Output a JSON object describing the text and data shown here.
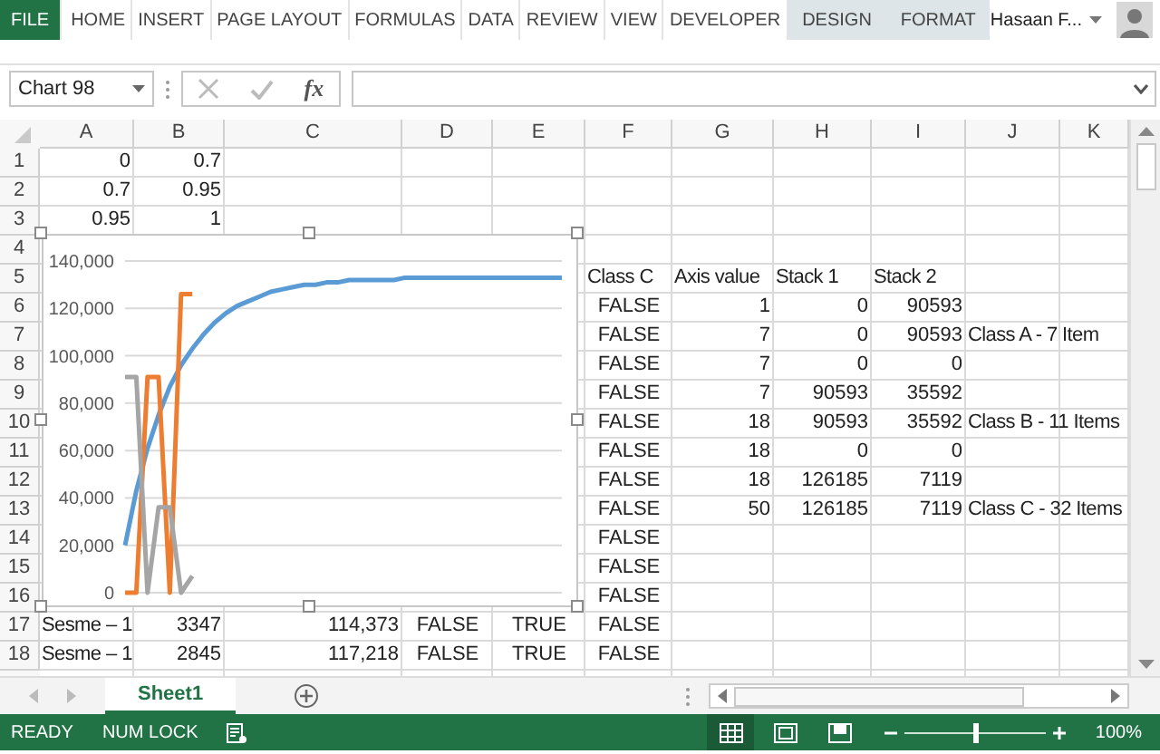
{
  "ribbon_tabs": [
    {
      "label": "FILE",
      "kind": "file"
    },
    {
      "label": "HOME",
      "kind": "tab"
    },
    {
      "label": "INSERT",
      "kind": "tab"
    },
    {
      "label": "PAGE LAYOUT",
      "kind": "tab"
    },
    {
      "label": "FORMULAS",
      "kind": "tab"
    },
    {
      "label": "DATA",
      "kind": "tab"
    },
    {
      "label": "REVIEW",
      "kind": "tab"
    },
    {
      "label": "VIEW",
      "kind": "tab"
    },
    {
      "label": "DEVELOPER",
      "kind": "tab"
    },
    {
      "label": "DESIGN",
      "kind": "context"
    },
    {
      "label": "FORMAT",
      "kind": "context"
    }
  ],
  "user": {
    "name": "Hasaan F..."
  },
  "formula_bar": {
    "name_box": "Chart 98",
    "fx_label": "fx"
  },
  "sheet": {
    "columns": [
      "A",
      "B",
      "C",
      "D",
      "E",
      "F",
      "G",
      "H",
      "I",
      "J",
      "K"
    ],
    "rows": [
      {
        "number": "1",
        "cells": {
          "A": {
            "value": "0",
            "kind": "number"
          },
          "B": {
            "value": "0.7",
            "kind": "number"
          }
        }
      },
      {
        "number": "2",
        "cells": {
          "A": {
            "value": "0.7",
            "kind": "number"
          },
          "B": {
            "value": "0.95",
            "kind": "number"
          }
        }
      },
      {
        "number": "3",
        "cells": {
          "A": {
            "value": "0.95",
            "kind": "number"
          },
          "B": {
            "value": "1",
            "kind": "number"
          }
        }
      },
      {
        "number": "4",
        "cells": {}
      },
      {
        "number": "5",
        "cells": {
          "F": {
            "value": "Class C",
            "kind": "text"
          },
          "G": {
            "value": "Axis value",
            "kind": "text"
          },
          "H": {
            "value": "Stack 1",
            "kind": "text"
          },
          "I": {
            "value": "Stack 2",
            "kind": "text"
          }
        }
      },
      {
        "number": "6",
        "cells": {
          "F": {
            "value": "FALSE",
            "kind": "bool"
          },
          "G": {
            "value": "1",
            "kind": "number"
          },
          "H": {
            "value": "0",
            "kind": "number"
          },
          "I": {
            "value": "90593",
            "kind": "number"
          }
        }
      },
      {
        "number": "7",
        "cells": {
          "F": {
            "value": "FALSE",
            "kind": "bool"
          },
          "G": {
            "value": "7",
            "kind": "number"
          },
          "H": {
            "value": "0",
            "kind": "number"
          },
          "I": {
            "value": "90593",
            "kind": "number"
          },
          "J": {
            "value": "Class A  -  7 Item",
            "kind": "text"
          }
        }
      },
      {
        "number": "8",
        "cells": {
          "F": {
            "value": "FALSE",
            "kind": "bool"
          },
          "G": {
            "value": "7",
            "kind": "number"
          },
          "H": {
            "value": "0",
            "kind": "number"
          },
          "I": {
            "value": "0",
            "kind": "number"
          }
        }
      },
      {
        "number": "9",
        "cells": {
          "F": {
            "value": "FALSE",
            "kind": "bool"
          },
          "G": {
            "value": "7",
            "kind": "number"
          },
          "H": {
            "value": "90593",
            "kind": "number"
          },
          "I": {
            "value": "35592",
            "kind": "number"
          }
        }
      },
      {
        "number": "10",
        "cells": {
          "F": {
            "value": "FALSE",
            "kind": "bool"
          },
          "G": {
            "value": "18",
            "kind": "number"
          },
          "H": {
            "value": "90593",
            "kind": "number"
          },
          "I": {
            "value": "35592",
            "kind": "number"
          },
          "J": {
            "value": "Class B - 11 Items",
            "kind": "text"
          }
        }
      },
      {
        "number": "11",
        "cells": {
          "F": {
            "value": "FALSE",
            "kind": "bool"
          },
          "G": {
            "value": "18",
            "kind": "number"
          },
          "H": {
            "value": "0",
            "kind": "number"
          },
          "I": {
            "value": "0",
            "kind": "number"
          }
        }
      },
      {
        "number": "12",
        "cells": {
          "F": {
            "value": "FALSE",
            "kind": "bool"
          },
          "G": {
            "value": "18",
            "kind": "number"
          },
          "H": {
            "value": "126185",
            "kind": "number"
          },
          "I": {
            "value": "7119",
            "kind": "number"
          }
        }
      },
      {
        "number": "13",
        "cells": {
          "F": {
            "value": "FALSE",
            "kind": "bool"
          },
          "G": {
            "value": "50",
            "kind": "number"
          },
          "H": {
            "value": "126185",
            "kind": "number"
          },
          "I": {
            "value": "7119",
            "kind": "number"
          },
          "J": {
            "value": "Class C - 32 Items",
            "kind": "text"
          }
        }
      },
      {
        "number": "14",
        "cells": {
          "F": {
            "value": "FALSE",
            "kind": "bool"
          }
        }
      },
      {
        "number": "15",
        "cells": {
          "F": {
            "value": "FALSE",
            "kind": "bool"
          }
        }
      },
      {
        "number": "16",
        "cells": {
          "F": {
            "value": "FALSE",
            "kind": "bool"
          }
        }
      },
      {
        "number": "17",
        "cells": {
          "A": {
            "value": "Sesme – 1",
            "kind": "text"
          },
          "B": {
            "value": "3347",
            "kind": "number"
          },
          "C": {
            "value": "114,373",
            "kind": "number"
          },
          "D": {
            "value": "FALSE",
            "kind": "bool"
          },
          "E": {
            "value": "TRUE",
            "kind": "bool"
          },
          "F": {
            "value": "FALSE",
            "kind": "bool"
          }
        }
      },
      {
        "number": "18",
        "cells": {
          "A": {
            "value": "Sesme – 1",
            "kind": "text"
          },
          "B": {
            "value": "2845",
            "kind": "number"
          },
          "C": {
            "value": "117,218",
            "kind": "number"
          },
          "D": {
            "value": "FALSE",
            "kind": "bool"
          },
          "E": {
            "value": "TRUE",
            "kind": "bool"
          },
          "F": {
            "value": "FALSE",
            "kind": "bool"
          }
        }
      }
    ]
  },
  "chart": {
    "chart_data": {
      "type": "line",
      "grid": true,
      "ylim": [
        0,
        140000
      ],
      "yticks": [
        {
          "value": 0,
          "label": "0"
        },
        {
          "value": 20000,
          "label": "20,000"
        },
        {
          "value": 40000,
          "label": "40,000"
        },
        {
          "value": 60000,
          "label": "60,000"
        },
        {
          "value": 80000,
          "label": "80,000"
        },
        {
          "value": 100000,
          "label": "100,000"
        },
        {
          "value": 120000,
          "label": "120,000"
        },
        {
          "value": 140000,
          "label": "140,000"
        }
      ],
      "series": [
        {
          "color": "#5b9bd5",
          "values": [
            20000,
            43000,
            61000,
            75000,
            87000,
            96000,
            103000,
            109000,
            114000,
            118000,
            121000,
            123000,
            125000,
            127000,
            128000,
            129000,
            130000,
            130000,
            131000,
            131000,
            132000,
            132000,
            132000,
            132000,
            132000,
            133000,
            133000,
            133000,
            133000,
            133000,
            133000,
            133000,
            133000,
            133000,
            133000,
            133000,
            133000,
            133000,
            133000,
            133000
          ]
        },
        {
          "color": "#ed7d31",
          "values": [
            0,
            0,
            91000,
            91000,
            0,
            126000,
            126000
          ]
        },
        {
          "color": "#a5a5a5",
          "values": [
            91000,
            91000,
            0,
            36000,
            36000,
            0,
            7000
          ]
        }
      ]
    }
  },
  "sheet_tabs": [
    {
      "label": "Sheet1",
      "selected": true
    }
  ],
  "status_bar": {
    "mode": "READY",
    "num_lock": "NUM LOCK",
    "views": [
      {
        "kind": "normal",
        "selected": true
      },
      {
        "kind": "page_layout",
        "selected": false
      },
      {
        "kind": "page_break",
        "selected": false
      }
    ],
    "zoom_slider": {
      "level": 0.5
    },
    "zoom": "100%"
  }
}
